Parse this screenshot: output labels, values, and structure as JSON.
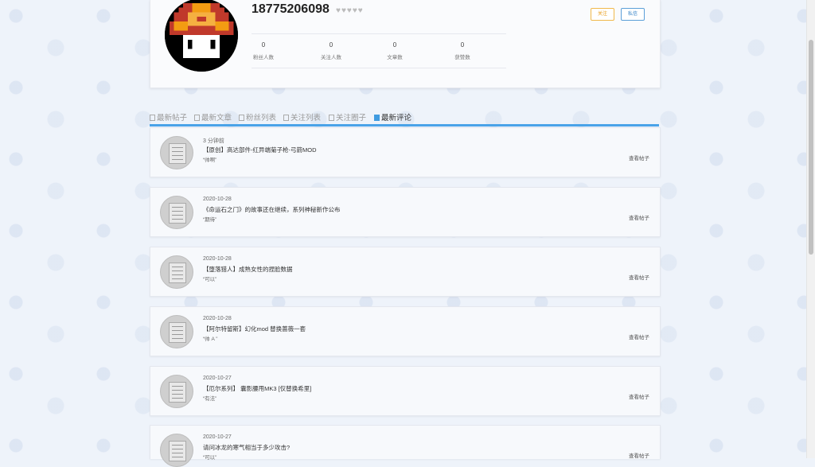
{
  "profile": {
    "username": "18775206098",
    "hearts": "♥♥♥♥♥",
    "follow_label": "关注",
    "message_label": "私信",
    "stats": [
      {
        "value": "0",
        "label": "粉丝人数"
      },
      {
        "value": "0",
        "label": "关注人数"
      },
      {
        "value": "0",
        "label": "文章数"
      },
      {
        "value": "0",
        "label": "获赞数"
      }
    ]
  },
  "tabs": [
    {
      "label": "最新帖子"
    },
    {
      "label": "最新文章"
    },
    {
      "label": "粉丝列表"
    },
    {
      "label": "关注列表"
    },
    {
      "label": "关注圈子"
    },
    {
      "label": "最新评论"
    }
  ],
  "comments": [
    {
      "date": "3 分钟前",
      "title": "【原创】高达部件-红异端菊子枪-弓箭MOD",
      "comment": "“帅啊”",
      "view_label": "查看帖子"
    },
    {
      "date": "2020-10-28",
      "title": "《命运石之门》的故事还在继续，系列神秘新作公布",
      "comment": "“期待”",
      "view_label": "查看帖子"
    },
    {
      "date": "2020-10-28",
      "title": "【堕落猎人】成熟女性的捏脸数据",
      "comment": "“可以”",
      "view_label": "查看帖子"
    },
    {
      "date": "2020-10-28",
      "title": "【阿尔特留斯】幻化mod 替换蔷薇一套",
      "comment": "“帅 A ”",
      "view_label": "查看帖子"
    },
    {
      "date": "2020-10-27",
      "title": "【厄尔系列】 囊影腰甩MK3 [仅替换希里]",
      "comment": "“有法”",
      "view_label": "查看帖子"
    },
    {
      "date": "2020-10-27",
      "title": "请问冰龙的寒气相当于多少攻击?",
      "comment": "“可以”",
      "view_label": "查看帖子"
    }
  ]
}
